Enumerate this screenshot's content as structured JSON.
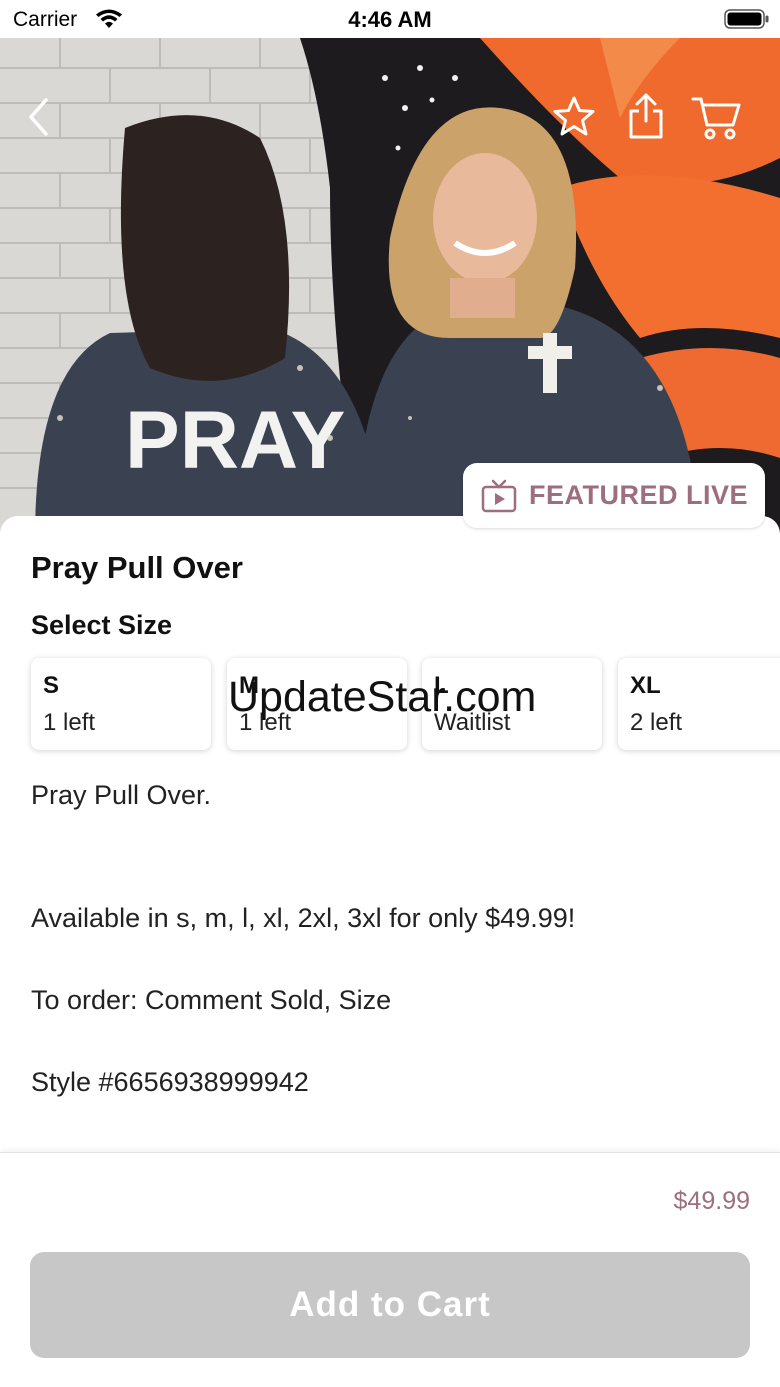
{
  "status_bar": {
    "carrier": "Carrier",
    "time": "4:46 AM"
  },
  "hero": {
    "image_description_icons": [
      "back-chevron-icon",
      "star-icon",
      "share-icon",
      "cart-icon"
    ],
    "shirt_left_text": "PRAY",
    "featured_label": "FEATURED LIVE"
  },
  "product": {
    "title": "Pray Pull Over",
    "select_size_label": "Select Size",
    "sizes": [
      {
        "name": "S",
        "stock": "1 left"
      },
      {
        "name": "M",
        "stock": "1 left"
      },
      {
        "name": "L",
        "stock": "Waitlist"
      },
      {
        "name": "XL",
        "stock": "2 left"
      }
    ],
    "description": [
      "Pray Pull Over.",
      "Available in s, m, l, xl, 2xl, 3xl for only $49.99!",
      "To order: Comment Sold, Size",
      "Style #6656938999942"
    ]
  },
  "watermark": "UpdateStar.com",
  "footer": {
    "price": "$49.99",
    "add_to_cart_label": "Add to Cart"
  },
  "colors": {
    "accent": "#9c6e80",
    "disabled_button": "#c7c7c7"
  }
}
